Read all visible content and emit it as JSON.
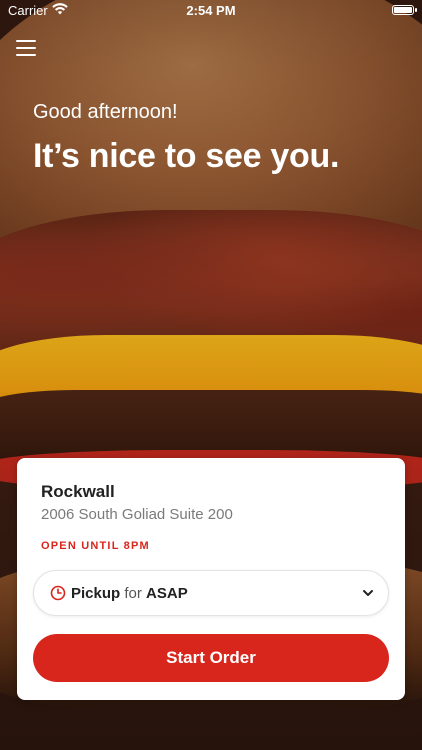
{
  "status_bar": {
    "carrier": "Carrier",
    "time": "2:54 PM"
  },
  "header": {
    "menu_icon": "hamburger-menu-icon"
  },
  "hero": {
    "greeting": "Good afternoon!",
    "headline": "It’s nice to see you."
  },
  "store_card": {
    "name": "Rockwall",
    "address": "2006 South Goliad   Suite 200",
    "hours": "OPEN UNTIL 8PM",
    "order_type": {
      "mode": "Pickup",
      "connector": "for",
      "time": "ASAP",
      "icon": "clock-icon"
    },
    "start_button_label": "Start Order"
  },
  "colors": {
    "accent": "#d9261c",
    "hours_text": "#d9261c",
    "card_background": "#ffffff"
  }
}
